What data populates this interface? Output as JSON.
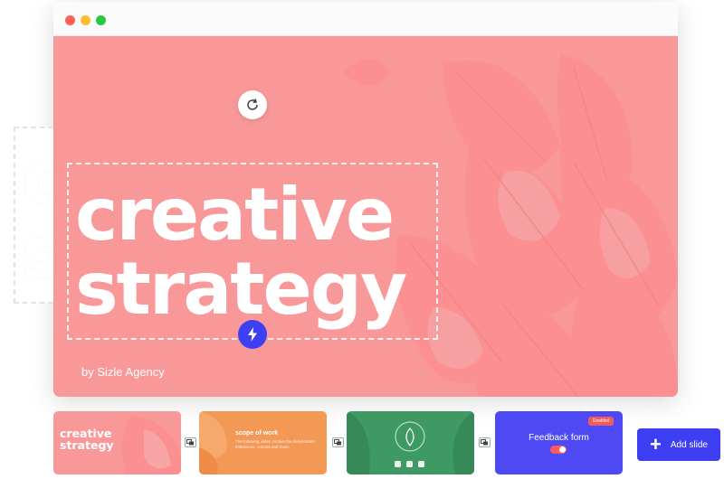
{
  "slide": {
    "title_line1": "creative",
    "title_line2": "strategy",
    "byline": "by Sizle Agency"
  },
  "thumbnails": [
    {
      "title_line1": "creative",
      "title_line2": "strategy"
    },
    {
      "title": "scope of work",
      "body": "The following slides contain the deliverables, milestones, outputs and more."
    },
    {
      "title": ""
    },
    {
      "label": "Feedback form",
      "badge": "Enabled"
    }
  ],
  "actions": {
    "add_slide": "Add slide"
  },
  "colors": {
    "slide_bg": "#f99899",
    "accent": "#3d3ff2",
    "thumb_orange": "#f49856",
    "thumb_green": "#3e9963",
    "thumb_purple": "#4d49f4"
  }
}
